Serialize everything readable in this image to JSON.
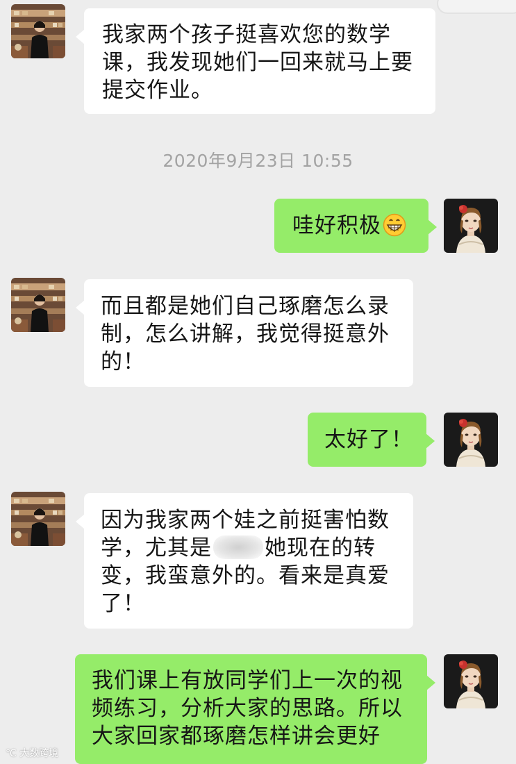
{
  "messages": [
    {
      "from": "other",
      "lines": [
        "我家两个孩子挺喜欢您的数学",
        "课，我发现她们一回来就马上要",
        "提交作业。"
      ]
    },
    {
      "from": "me",
      "text": "哇好积极",
      "emoji": "grinning-face-emoji"
    },
    {
      "from": "other",
      "lines": [
        "而且都是她们自己琢磨怎么录",
        "制，怎么讲解，我觉得挺意外",
        "的！"
      ]
    },
    {
      "from": "me",
      "text": "太好了！"
    },
    {
      "from": "other",
      "line1": "因为我家两个娃之前挺害怕数",
      "line2a": "学，尤其是",
      "line2b": "她现在的转",
      "line3": "变，我蛮意外的。看来是真爱",
      "line4": "了！"
    },
    {
      "from": "me",
      "lines": [
        "我们课上有放同学们上一次的视",
        "频练习，分析大家的思路。所以",
        "大家回家都琢磨怎样讲会更好"
      ]
    }
  ],
  "timestamp": "2020年9月23日 10:55",
  "watermark": "大数跨境",
  "colors": {
    "background": "#ededed",
    "incoming_bubble": "#ffffff",
    "outgoing_bubble": "#95ec69",
    "timestamp": "#a3a3a3"
  },
  "icons": {
    "teacher_avatar": "avatar-woman-shop",
    "user_avatar": "avatar-painted-girl",
    "redaction": "blurred-name"
  }
}
